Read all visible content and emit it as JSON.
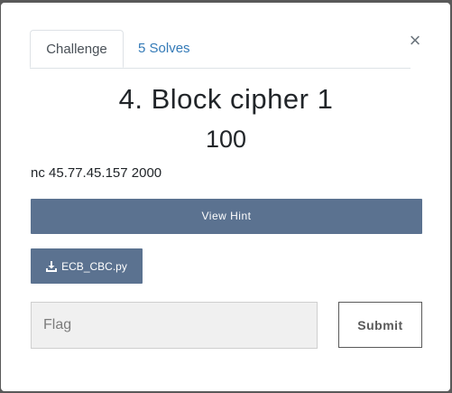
{
  "tabs": [
    {
      "label": "Challenge",
      "active": true
    },
    {
      "label": "5 Solves",
      "active": false
    }
  ],
  "close_label": "×",
  "challenge": {
    "title": "4. Block cipher 1",
    "points": "100",
    "description": "nc 45.77.45.157 2000"
  },
  "hint_button": {
    "label": "View Hint"
  },
  "file_button": {
    "label": "ECB_CBC.py",
    "icon": "download-icon"
  },
  "flag_form": {
    "placeholder": "Flag",
    "value": "",
    "submit_label": "Submit"
  },
  "colors": {
    "button_bg": "#5b7290",
    "link": "#337ab7",
    "backdrop": "#595959"
  }
}
